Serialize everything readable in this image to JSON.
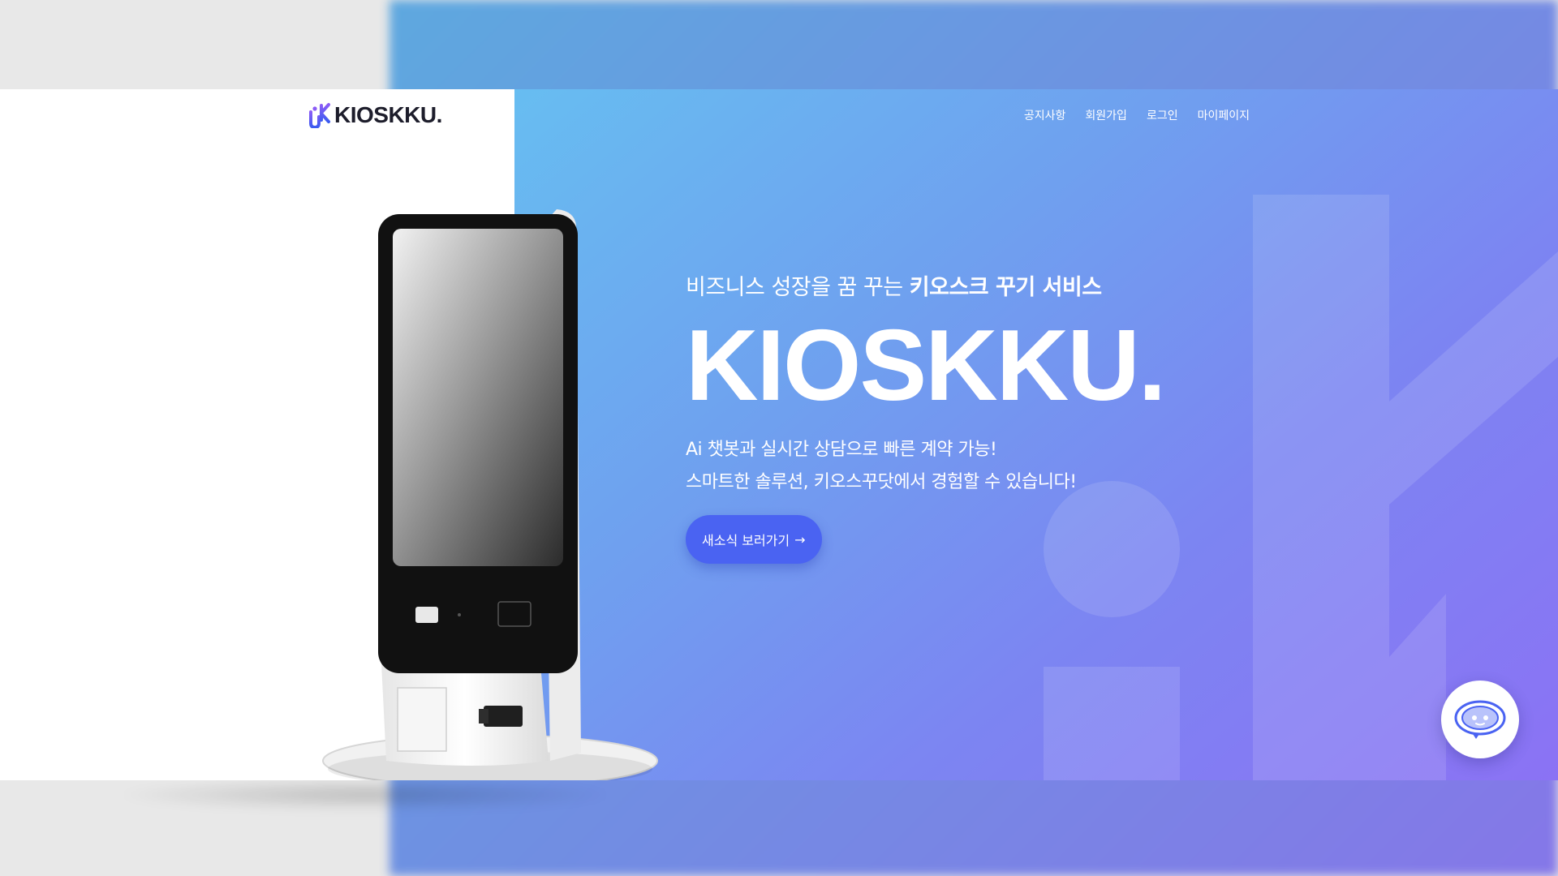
{
  "header": {
    "logo_text": "KIOSKKU.",
    "nav": [
      "공지사항",
      "회원가입",
      "로그인",
      "마이페이지"
    ]
  },
  "hero": {
    "subtitle_plain": "비즈니스 성장을 꿈 꾸는 ",
    "subtitle_bold": "키오스크 꾸기 서비스",
    "title": "KIOSKKU.",
    "desc_line1": "Ai 챗봇과 실시간 상담으로 빠른 계약 가능!",
    "desc_line2": "스마트한 솔루션, 키오스꾸닷에서 경험할 수 있습니다!",
    "cta_label": "새소식 보러가기",
    "cta_arrow": "→"
  },
  "icons": {
    "logo": "kioskku-logo-mark",
    "chat": "chatbot-icon"
  },
  "colors": {
    "accent": "#4a63f2",
    "gradient_start": "#67bdf1",
    "gradient_end": "#8b72f4",
    "logo_text": "#1d1d2b"
  }
}
